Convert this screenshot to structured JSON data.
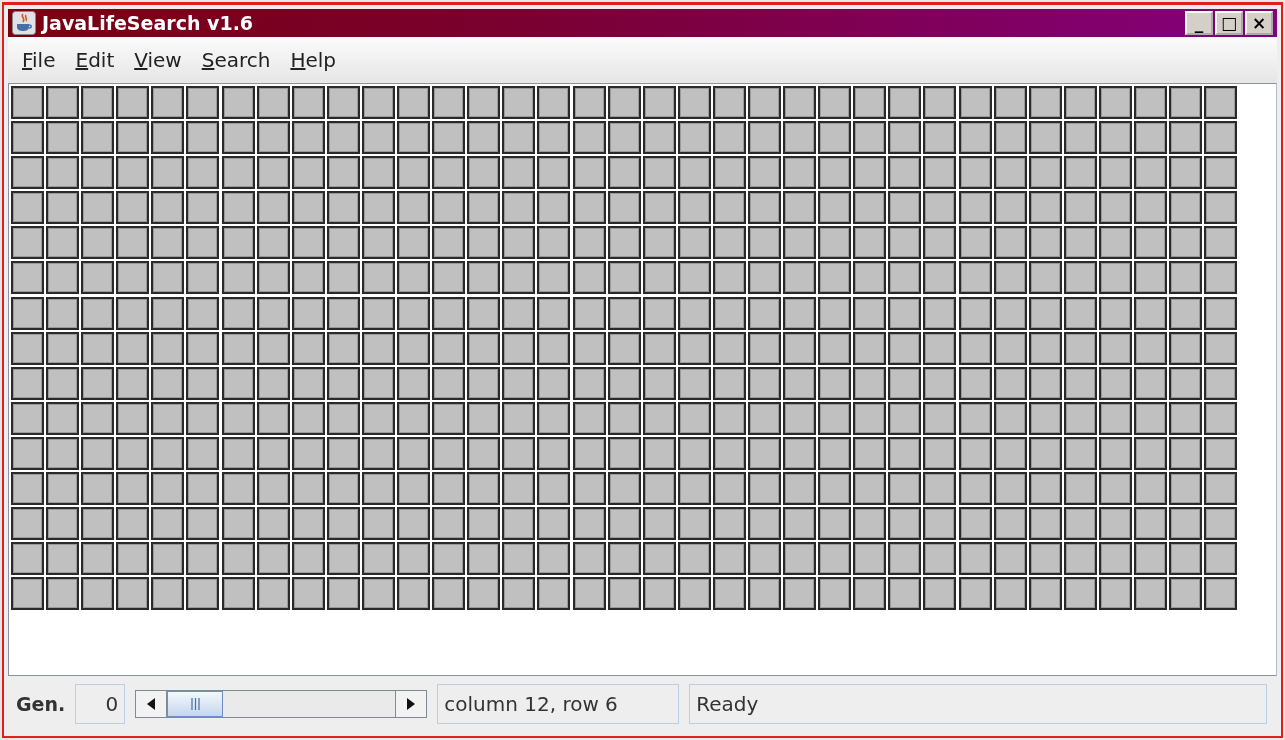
{
  "window": {
    "title": "JavaLifeSearch v1.6",
    "controls": [
      "_",
      "□",
      "×"
    ]
  },
  "menu": [
    {
      "label": "File",
      "first_letter_underlined": true
    },
    {
      "label": "Edit",
      "first_letter_underlined": true
    },
    {
      "label": "View",
      "first_letter_underlined": true
    },
    {
      "label": "Search",
      "first_letter_underlined": true
    },
    {
      "label": "Help",
      "first_letter_underlined": true
    }
  ],
  "grid": {
    "rows": [
      {
        "alive": [
          false,
          false,
          false,
          false,
          false,
          false,
          false,
          false,
          false,
          false,
          false,
          false,
          false,
          false,
          false,
          false,
          false,
          false,
          false,
          false,
          false,
          false,
          false,
          false,
          false,
          false,
          false,
          false,
          false,
          false,
          false,
          false,
          false,
          false,
          false
        ]
      },
      {
        "alive": [
          false,
          false,
          false,
          false,
          false,
          false,
          false,
          false,
          false,
          false,
          false,
          false,
          false,
          false,
          false,
          false,
          false,
          false,
          false,
          false,
          false,
          false,
          false,
          false,
          false,
          false,
          false,
          false,
          false,
          false,
          false,
          false,
          false,
          false,
          false
        ]
      },
      {
        "alive": [
          false,
          false,
          false,
          false,
          false,
          false,
          false,
          false,
          false,
          false,
          false,
          false,
          false,
          false,
          false,
          false,
          false,
          false,
          false,
          false,
          false,
          false,
          false,
          false,
          false,
          false,
          false,
          false,
          false,
          false,
          false,
          false,
          false,
          false,
          false
        ]
      },
      {
        "alive": [
          false,
          false,
          false,
          false,
          false,
          false,
          false,
          false,
          false,
          false,
          false,
          false,
          false,
          false,
          false,
          false,
          false,
          false,
          false,
          false,
          false,
          false,
          false,
          false,
          false,
          false,
          false,
          false,
          false,
          false,
          false,
          false,
          false,
          false,
          false
        ]
      },
      {
        "alive": [
          false,
          false,
          false,
          false,
          false,
          false,
          false,
          false,
          false,
          false,
          false,
          false,
          false,
          false,
          false,
          false,
          false,
          false,
          false,
          false,
          false,
          false,
          false,
          false,
          false,
          false,
          false,
          false,
          false,
          false,
          false,
          false,
          false,
          false,
          false
        ]
      },
      {
        "alive": [
          false,
          false,
          false,
          false,
          false,
          false,
          false,
          false,
          false,
          false,
          false,
          false,
          false,
          false,
          false,
          false,
          false,
          false,
          false,
          false,
          false,
          false,
          false,
          false,
          false,
          false,
          false,
          false,
          false,
          false,
          false,
          false,
          false,
          false,
          false
        ]
      },
      {
        "alive": [
          false,
          false,
          false,
          false,
          false,
          false,
          false,
          false,
          false,
          false,
          false,
          false,
          false,
          false,
          false,
          false,
          false,
          false,
          false,
          false,
          false,
          false,
          false,
          false,
          false,
          false,
          false,
          false,
          false,
          false,
          false,
          false,
          false,
          false,
          false
        ]
      },
      {
        "alive": [
          false,
          false,
          false,
          false,
          false,
          false,
          false,
          false,
          false,
          false,
          false,
          false,
          false,
          false,
          false,
          false,
          false,
          false,
          false,
          false,
          false,
          false,
          false,
          false,
          false,
          false,
          false,
          false,
          false,
          false,
          false,
          false,
          false,
          false,
          false
        ]
      },
      {
        "alive": [
          false,
          false,
          false,
          false,
          false,
          false,
          false,
          false,
          false,
          false,
          false,
          false,
          false,
          false,
          false,
          false,
          false,
          false,
          false,
          false,
          false,
          false,
          false,
          false,
          false,
          false,
          false,
          false,
          false,
          false,
          false,
          false,
          false,
          false,
          false
        ]
      },
      {
        "alive": [
          false,
          false,
          false,
          false,
          false,
          false,
          false,
          false,
          false,
          false,
          false,
          false,
          false,
          false,
          false,
          false,
          false,
          false,
          false,
          false,
          false,
          false,
          false,
          false,
          false,
          false,
          false,
          false,
          false,
          false,
          false,
          false,
          false,
          false,
          false
        ]
      },
      {
        "alive": [
          false,
          false,
          false,
          false,
          false,
          false,
          false,
          false,
          false,
          false,
          false,
          false,
          false,
          false,
          false,
          false,
          false,
          false,
          false,
          false,
          false,
          false,
          false,
          false,
          false,
          false,
          false,
          false,
          false,
          false,
          false,
          false,
          false,
          false,
          false
        ]
      },
      {
        "alive": [
          false,
          false,
          false,
          false,
          false,
          false,
          false,
          false,
          false,
          false,
          false,
          false,
          false,
          false,
          false,
          false,
          false,
          false,
          false,
          false,
          false,
          false,
          false,
          false,
          false,
          false,
          false,
          false,
          false,
          false,
          false,
          false,
          false,
          false,
          false
        ]
      },
      {
        "alive": [
          false,
          false,
          false,
          false,
          false,
          false,
          false,
          false,
          false,
          false,
          false,
          false,
          false,
          false,
          false,
          false,
          false,
          false,
          false,
          false,
          false,
          false,
          false,
          false,
          false,
          false,
          false,
          false,
          false,
          false,
          false,
          false,
          false,
          false,
          false
        ]
      },
      {
        "alive": [
          false,
          false,
          false,
          false,
          false,
          false,
          false,
          false,
          false,
          false,
          false,
          false,
          false,
          false,
          false,
          false,
          false,
          false,
          false,
          false,
          false,
          false,
          false,
          false,
          false,
          false,
          false,
          false,
          false,
          false,
          false,
          false,
          false,
          false,
          false
        ]
      },
      {
        "alive": [
          false,
          false,
          false,
          false,
          false,
          false,
          false,
          false,
          false,
          false,
          false,
          false,
          false,
          false,
          false,
          false,
          false,
          false,
          false,
          false,
          false,
          false,
          false,
          false,
          false,
          false,
          false,
          false,
          false,
          false,
          false,
          false,
          false,
          false,
          false
        ]
      }
    ]
  },
  "status_bar": {
    "gen_label": "Gen.",
    "gen_value": "0",
    "position": "column 12, row 6",
    "message": "Ready"
  }
}
